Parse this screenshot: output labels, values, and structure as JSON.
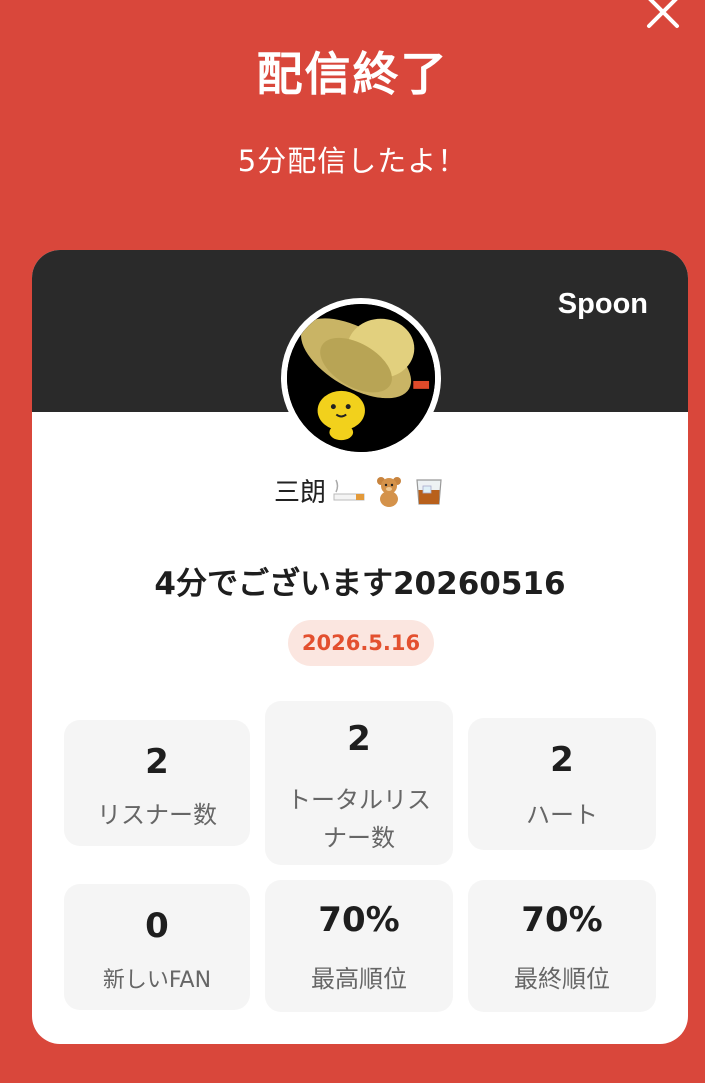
{
  "header": {
    "title": "配信終了",
    "subtitle": "5分配信したよ！"
  },
  "card": {
    "brand": "Spoon",
    "dj_name": "三朗",
    "dj_emojis": [
      "cigarette-icon",
      "teddy-bear-icon",
      "whiskey-glass-icon"
    ],
    "live_title": "4分でございます20260516",
    "date": "2026.5.16",
    "stats": [
      {
        "value": "2",
        "label": "リスナー数"
      },
      {
        "value": "2",
        "label": "トータルリスナー数"
      },
      {
        "value": "2",
        "label": "ハート"
      },
      {
        "value": "0",
        "label": "新しいFAN"
      },
      {
        "value": "70%",
        "label": "最高順位"
      },
      {
        "value": "70%",
        "label": "最終順位"
      }
    ]
  },
  "colors": {
    "background": "#d9473b",
    "card_header": "#2a2a2a",
    "accent": "#e3502f",
    "badge_bg": "#fbe6e0"
  }
}
